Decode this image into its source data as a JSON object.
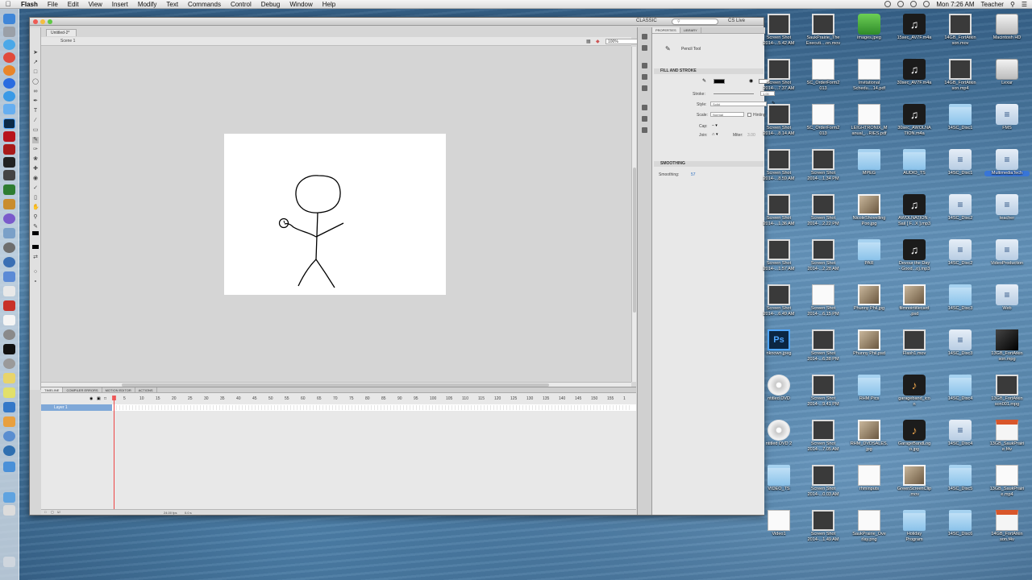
{
  "menubar": {
    "app_name": "Flash",
    "menus": [
      "File",
      "Edit",
      "View",
      "Insert",
      "Modify",
      "Text",
      "Commands",
      "Control",
      "Debug",
      "Window",
      "Help"
    ],
    "clock": "Mon 7:26 AM",
    "user": "Teacher"
  },
  "flash": {
    "workspace": "CLASSIC",
    "cs_live": "CS Live",
    "document_tab": "Untitled-2*",
    "scene": "Scene 1",
    "zoom": "100%",
    "timeline_tabs": [
      "TIMELINE",
      "COMPILER ERRORS",
      "MOTION EDITOR",
      "ACTIONS"
    ],
    "frame_numbers": [
      "5",
      "10",
      "15",
      "20",
      "25",
      "30",
      "35",
      "40",
      "45",
      "50",
      "55",
      "60",
      "65",
      "70",
      "75",
      "80",
      "85",
      "90",
      "95",
      "100",
      "105",
      "110",
      "115",
      "120",
      "125",
      "130",
      "135",
      "140",
      "145",
      "150",
      "155",
      "1"
    ],
    "layer_name": "Layer 1",
    "fps": "24.00 fps",
    "elapsed_time": "0.0 s",
    "properties": {
      "tabs": [
        "PROPERTIES",
        "LIBRARY"
      ],
      "tool_name": "Pencil Tool",
      "fill_stroke_header": "FILL AND STROKE",
      "stroke_label": "Stroke:",
      "stroke_value": "1.00",
      "style_label": "Style:",
      "style_value": "Solid",
      "scale_label": "Scale:",
      "scale_value": "Normal",
      "hinting_label": "Hinting",
      "cap_label": "Cap:",
      "join_label": "Join:",
      "miter_label": "Miter:",
      "miter_value": "3.00",
      "smoothing_header": "SMOOTHING",
      "smoothing_label": "Smoothing:",
      "smoothing_value": "57"
    }
  },
  "desktop": {
    "columns": [
      [
        {
          "label": "Screen Shot\n2014-...5.42 AM",
          "icon": "screenshot-icon"
        },
        {
          "label": "Screen Shot\n2014-...7.37 AM",
          "icon": "screenshot-icon"
        },
        {
          "label": "Screen Shot\n2014-...8.14 AM",
          "icon": "screenshot-icon"
        },
        {
          "label": "Screen Shot\n2014-...8.59 AM",
          "icon": "screenshot-icon"
        },
        {
          "label": "Screen Shot\n2014-...1.36 AM",
          "icon": "screenshot-icon"
        },
        {
          "label": "Screen Shot\n2014-...1.57 AM",
          "icon": "screenshot-icon"
        },
        {
          "label": "Screen Shot\n2014-...6.49 AM",
          "icon": "screenshot-icon"
        },
        {
          "label": "nknown.jpeg",
          "icon": "photoshop-icon"
        },
        {
          "label": "ntitled DVD",
          "icon": "dvd-icon"
        },
        {
          "label": "ntitled DVD 2",
          "icon": "dvd-icon"
        },
        {
          "label": "VIDEO_TS",
          "icon": "folder-icon"
        },
        {
          "label": "Video1",
          "icon": "document-icon"
        }
      ],
      [
        {
          "label": "SaukPrairie_The\nExecuti....on.mov",
          "icon": "screenshot-icon"
        },
        {
          "label": "SC_OrderForm2\n013",
          "icon": "document-icon"
        },
        {
          "label": "SC_OrderForm2\n013",
          "icon": "document-icon"
        },
        {
          "label": "Screen Shot\n2014-...1.34 PM",
          "icon": "screenshot-icon"
        },
        {
          "label": "Screen Shot\n2014-...2.22 PM",
          "icon": "screenshot-icon"
        },
        {
          "label": "Screen Shot\n2014-...2.28 AM",
          "icon": "screenshot-icon"
        },
        {
          "label": "Screen Shot\n2014-...6.15 PM",
          "icon": "document-icon"
        },
        {
          "label": "Screen Shot\n2014-...6.38 PM",
          "icon": "screenshot-icon"
        },
        {
          "label": "Screen Shot\n2014-...9.41 PM",
          "icon": "screenshot-icon"
        },
        {
          "label": "Screen Shot\n2014-...7.05 AM",
          "icon": "screenshot-icon"
        },
        {
          "label": "Screen Shot\n2014-...0.03 AM",
          "icon": "screenshot-icon"
        },
        {
          "label": "Screen Shot\n2014-...1.49 AM",
          "icon": "screenshot-icon"
        }
      ],
      [
        {
          "label": "images.jpeg",
          "icon": "image-icon"
        },
        {
          "label": "Invitational\nSchedu....14.pdf",
          "icon": "document-icon"
        },
        {
          "label": "LEIGHTRONIX_M\nanual_...RIES.pdf",
          "icon": "document-icon"
        },
        {
          "label": "MPEG",
          "icon": "folder-icon"
        },
        {
          "label": "NicoleShovelling\nPoo.jpg",
          "icon": "photo-icon"
        },
        {
          "label": "PAR",
          "icon": "folder-icon"
        },
        {
          "label": "Phunny Phil.jpg",
          "icon": "photo-icon"
        },
        {
          "label": "Phunny Phil.psd",
          "icon": "photo-icon"
        },
        {
          "label": "RHM Pics",
          "icon": "folder-icon"
        },
        {
          "label": "RHM_DVDSALES.\njpg",
          "icon": "photo-icon"
        },
        {
          "label": "rhminputs",
          "icon": "document-icon"
        },
        {
          "label": "SaukPrairie_Ove\nrlay.png",
          "icon": "document-icon"
        }
      ],
      [
        {
          "label": "15sec_AV7F.m4a",
          "icon": "music-icon"
        },
        {
          "label": "30sec_AV7F.m4a",
          "icon": "music-icon"
        },
        {
          "label": "30sec_AWOLNA\nTION.m4a",
          "icon": "music-icon"
        },
        {
          "label": "AUDIO_TS",
          "icon": "folder-icon"
        },
        {
          "label": "AWOLNATION -\nSail [ F...X ].mp3",
          "icon": "music-icon"
        },
        {
          "label": "Devour the Day\n- Good...o).mp3",
          "icon": "music-icon"
        },
        {
          "label": "filmnoirtitlecard\n.psd",
          "icon": "photo-icon"
        },
        {
          "label": "Flash1.mov",
          "icon": "screenshot-icon"
        },
        {
          "label": "garageband_ico\nn",
          "icon": "guitar-icon"
        },
        {
          "label": "GarageBandLog\no.jpg",
          "icon": "guitar-icon"
        },
        {
          "label": "GreenScreenClip\n.mov",
          "icon": "photo-icon"
        },
        {
          "label": "Holiday\nProgram",
          "icon": "folder-icon"
        }
      ],
      [
        {
          "label": "14GB_FortAtkin\nson.mov",
          "icon": "screenshot-icon"
        },
        {
          "label": "14GB_FortAtkin\nson.mp4",
          "icon": "screenshot-icon"
        },
        {
          "label": "14SC_Disc1",
          "icon": "folder-icon"
        },
        {
          "label": "14SC_Disc1",
          "icon": "app-icon"
        },
        {
          "label": "14SC_Disc2",
          "icon": "app-icon"
        },
        {
          "label": "14SC_Disc2",
          "icon": "app-icon"
        },
        {
          "label": "14SC_Disc3",
          "icon": "folder-icon"
        },
        {
          "label": "14SC_Disc3",
          "icon": "app-icon"
        },
        {
          "label": "14SC_Disc4",
          "icon": "folder-icon"
        },
        {
          "label": "14SC_Disc4",
          "icon": "app-icon"
        },
        {
          "label": "14SC_Disc5",
          "icon": "folder-icon"
        },
        {
          "label": "14SC_Disc6",
          "icon": "folder-icon"
        }
      ],
      [
        {
          "label": "Macintosh HD",
          "icon": "disk-icon"
        },
        {
          "label": "Lexar",
          "icon": "disk-icon"
        },
        {
          "label": "FMS",
          "icon": "app-icon"
        },
        {
          "label": "MultimediaTech",
          "icon": "app-icon",
          "selected": true
        },
        {
          "label": "teacher",
          "icon": "app-icon"
        },
        {
          "label": "VideoProduction",
          "icon": "app-icon"
        },
        {
          "label": "Web",
          "icon": "app-icon"
        },
        {
          "label": "13GB_FortAtkin\nson.mpg",
          "icon": "black-icon"
        },
        {
          "label": "13GB_FortAtkin\nson001.mpg",
          "icon": "screenshot-icon"
        },
        {
          "label": "13GB_SaukPrairi\ne.f4v",
          "icon": "flv-icon"
        },
        {
          "label": "13GB_SaukPrairi\ne.mp4",
          "icon": "document-icon"
        },
        {
          "label": "14GB_FortAtkin\nson.f4v",
          "icon": "flv-icon"
        }
      ]
    ]
  }
}
